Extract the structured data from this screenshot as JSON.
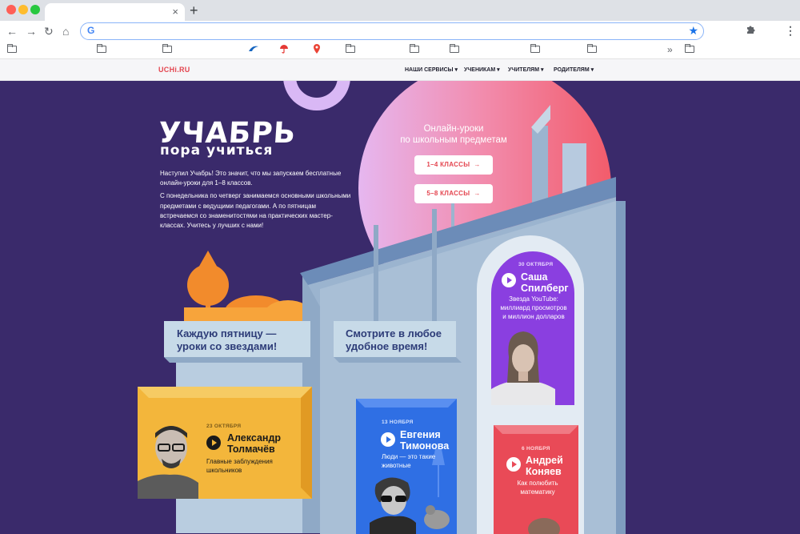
{
  "browser": {
    "tab_close": "×",
    "new_tab": "+",
    "nav": {
      "back": "←",
      "forward": "→",
      "reload": "↻",
      "home": "⌂"
    },
    "omnibox": {
      "provider_icon": "G",
      "star": "★",
      "value": ""
    },
    "extensions_icon": "puzzle-icon",
    "menu_icon": "⋮",
    "bookmarks_more": "»"
  },
  "site": {
    "logo": "UCHi.RU",
    "nav": [
      {
        "label": "НАШИ СЕРВИСЫ ▾"
      },
      {
        "label": "УЧЕНИКАМ ▾"
      },
      {
        "label": "УЧИТЕЛЯМ ▾"
      },
      {
        "label": "РОДИТЕЛЯМ ▾"
      }
    ]
  },
  "hero": {
    "title": "УЧАБРЬ",
    "subtitle": "пора учиться",
    "intro": [
      "Наступил Учабрь! Это значит, что мы запускаем бесплатные онлайн-уроки для 1–8 классов.",
      "С понедельника по четверг занимаемся основными школьными предметами с ведущими педагогами. А по пятницам встречаемся со знаменитостями на практических мастер-классах. Учитесь у лучших с нами!"
    ],
    "online_title_1": "Онлайн-уроки",
    "online_title_2": "по школьным предметам",
    "buttons": [
      {
        "label": "1–4 КЛАССЫ",
        "arrow": "→"
      },
      {
        "label": "5–8 КЛАССЫ",
        "arrow": "→"
      }
    ],
    "banner_left_1": "Каждую пятницу —",
    "banner_left_2": "уроки со звездами!",
    "banner_right_1": "Смотрите в любое",
    "banner_right_2": "удобное время!"
  },
  "lessons": [
    {
      "date": "30 ОКТЯБРЯ",
      "name_1": "Саша",
      "name_2": "Спилберг",
      "desc": [
        "Звезда YouTube:",
        "миллиард просмотров",
        "и миллион долларов"
      ]
    },
    {
      "date": "23 ОКТЯБРЯ",
      "name_1": "Александр",
      "name_2": "Толмачёв",
      "desc": [
        "Главные заблуждения",
        "школьников"
      ]
    },
    {
      "date": "13 НОЯБРЯ",
      "name_1": "Евгения",
      "name_2": "Тимонова",
      "desc": [
        "Люди — это такие",
        "животные"
      ]
    },
    {
      "date": "6 НОЯБРЯ",
      "name_1": "Андрей",
      "name_2": "Коняев",
      "desc": [
        "Как полюбить",
        "математику"
      ]
    }
  ],
  "colors": {
    "brand": "#e4454f",
    "hero_bg": "#3a2a6b",
    "purple_card": "#8a3fe0",
    "yellow_card": "#f3b63b",
    "blue_card": "#2f6fe4",
    "red_card": "#e94a57"
  }
}
